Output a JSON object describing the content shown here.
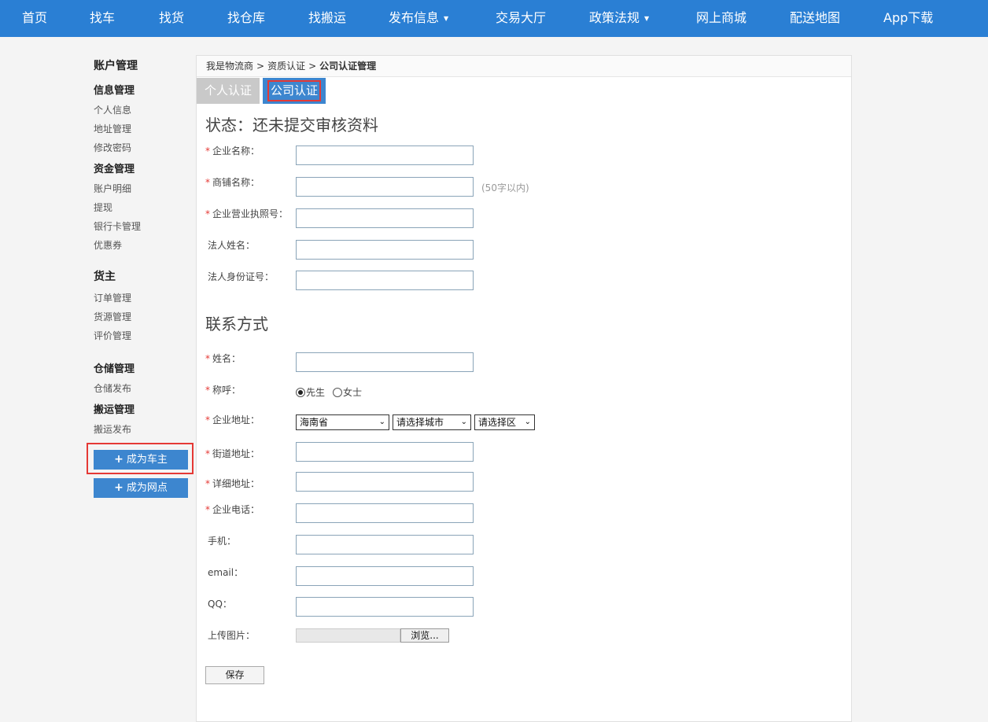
{
  "nav": {
    "items": [
      {
        "label": "首页"
      },
      {
        "label": "找车"
      },
      {
        "label": "找货"
      },
      {
        "label": "找仓库"
      },
      {
        "label": "找搬运"
      },
      {
        "label": "发布信息",
        "caret": "▼"
      },
      {
        "label": "交易大厅"
      },
      {
        "label": "政策法规",
        "caret": "▼"
      },
      {
        "label": "网上商城"
      },
      {
        "label": "配送地图"
      },
      {
        "label": "App下载"
      }
    ]
  },
  "sidebar": {
    "account_title": "账户管理",
    "info_title": "信息管理",
    "info_items": [
      "个人信息",
      "地址管理",
      "修改密码"
    ],
    "fund_title": "资金管理",
    "fund_items": [
      "账户明细",
      "提现",
      "银行卡管理",
      "优惠券"
    ],
    "shipper_title": "货主",
    "shipper_items": [
      "订单管理",
      "货源管理",
      "评价管理"
    ],
    "storage_title": "仓储管理",
    "storage_items": [
      "仓储发布"
    ],
    "moving_title": "搬运管理",
    "moving_items": [
      "搬运发布"
    ],
    "btn_plus": "+",
    "btn_become_owner": "成为车主",
    "btn_become_outlet": "成为网点"
  },
  "breadcrumb": {
    "items": [
      "我是物流商",
      "资质认证"
    ],
    "separator": ">",
    "current": "公司认证管理"
  },
  "tabs": {
    "personal": "个人认证",
    "company": "公司认证"
  },
  "form": {
    "status_title": "状态：还未提交审核资料",
    "required_mark": "*",
    "fields": {
      "company_name": "企业名称：",
      "shop_name": "商铺名称：",
      "license_no": "企业营业执照号：",
      "legal_name": "法人姓名：",
      "legal_id": "法人身份证号："
    },
    "shop_name_hint": "(50字以内)",
    "contact_title": "联系方式",
    "contact": {
      "name": "姓名：",
      "salutation": "称呼：",
      "salutation_options": [
        "先生",
        "女士"
      ],
      "address": "企业地址：",
      "province_value": "海南省",
      "city_value": "请选择城市",
      "district_value": "请选择区",
      "street": "街道地址：",
      "detail": "详细地址：",
      "phone": "企业电话：",
      "mobile": "手机：",
      "email": "email：",
      "qq": "QQ：",
      "upload": "上传图片："
    },
    "browse_label": "浏览...",
    "save_label": "保存"
  }
}
